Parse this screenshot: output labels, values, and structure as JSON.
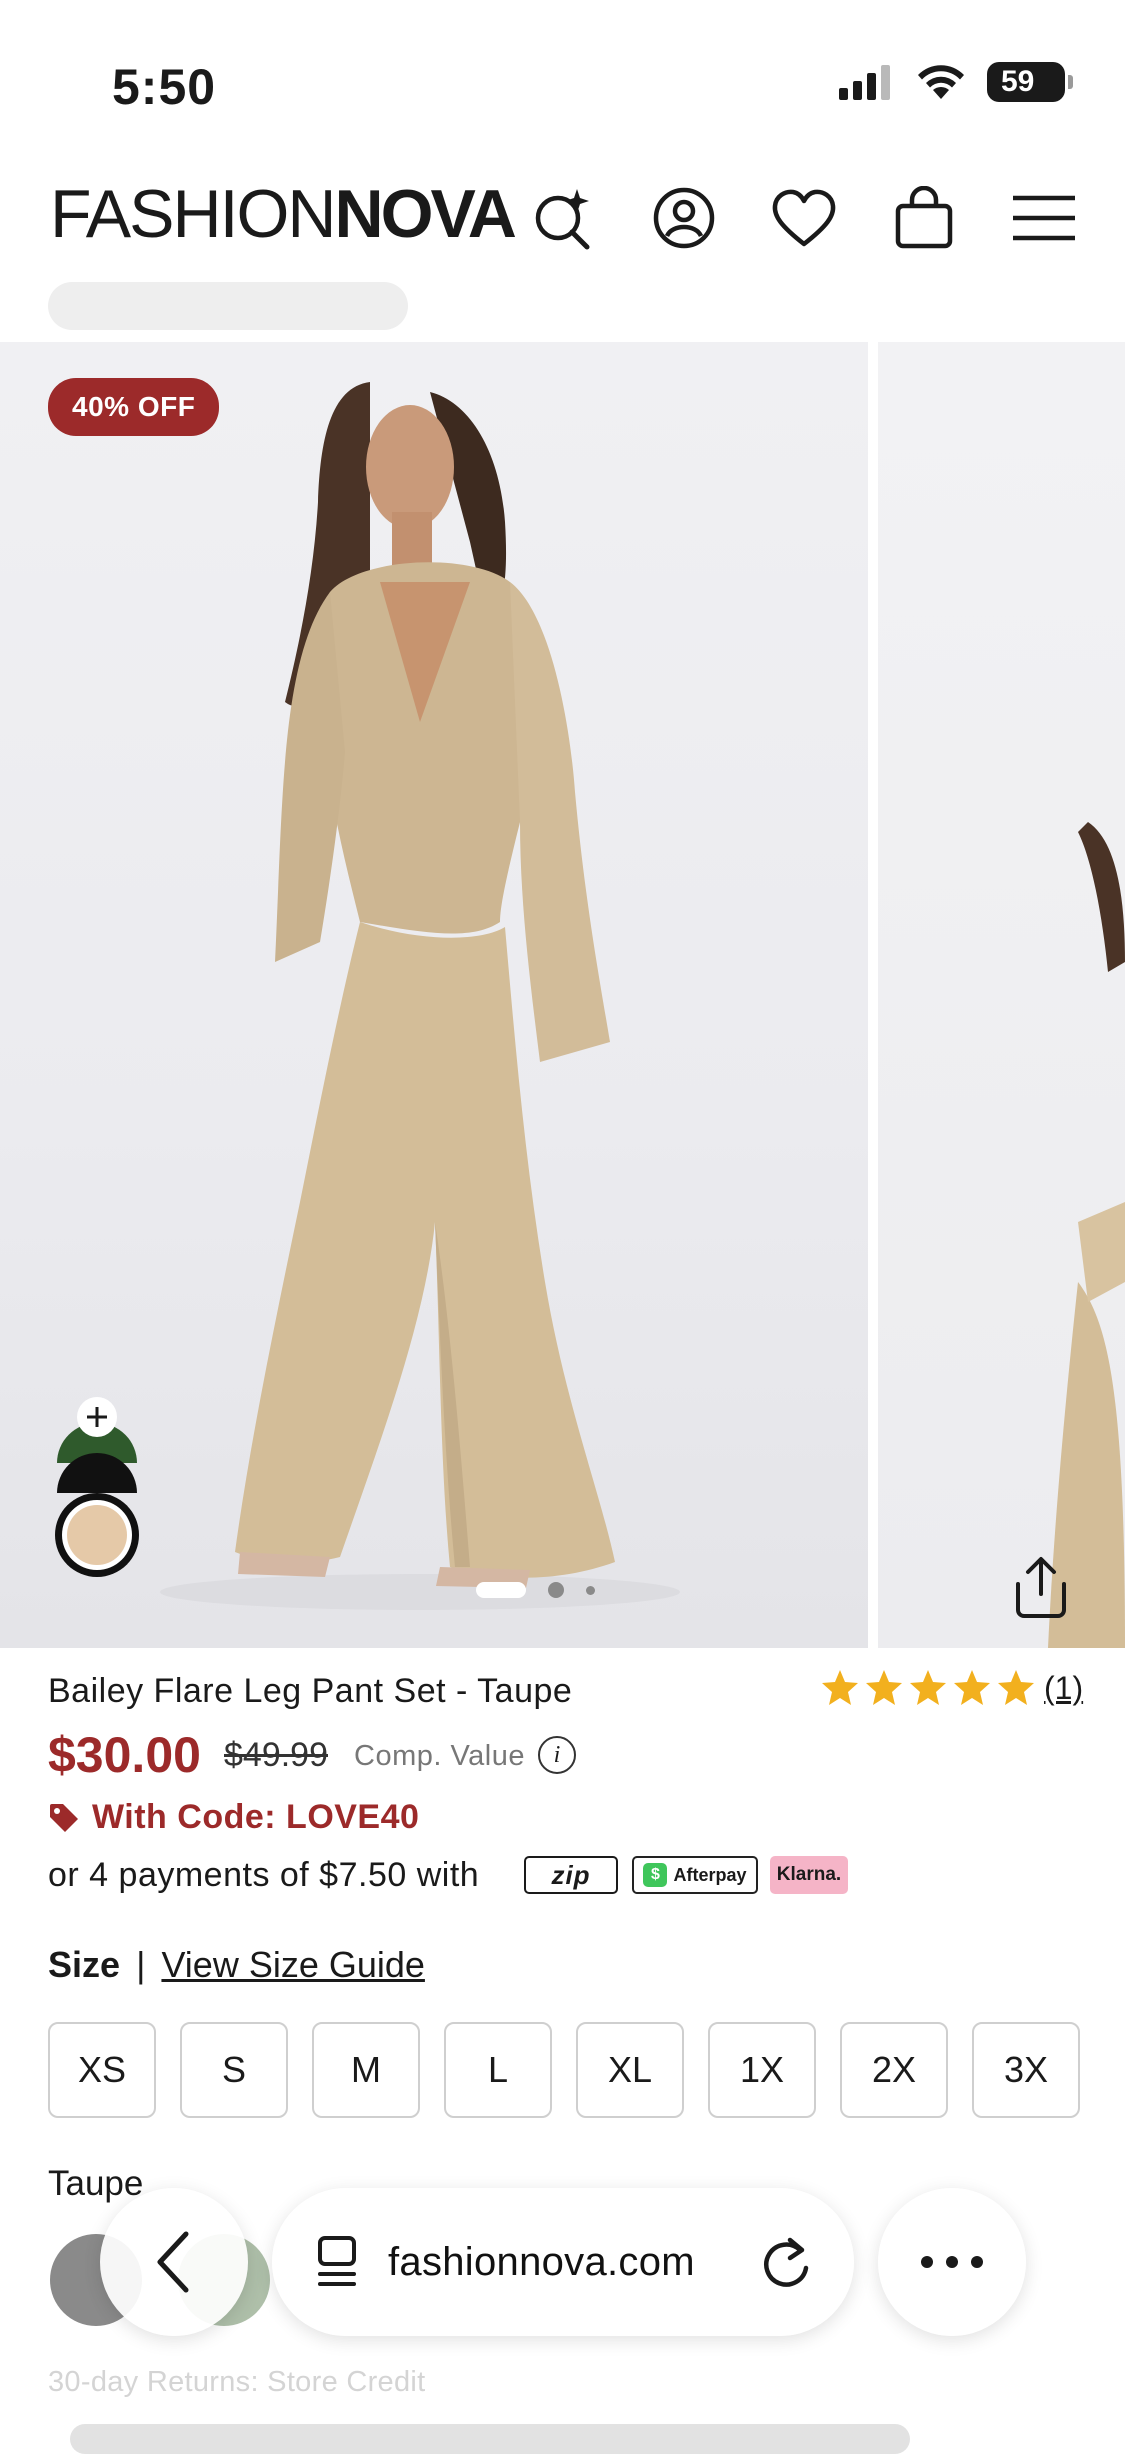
{
  "status_bar": {
    "time": "5:50",
    "battery": "59"
  },
  "header": {
    "logo_light": "FASHION",
    "logo_bold": "NOVA",
    "icons": [
      "search-sparkle-icon",
      "account-icon",
      "heart-icon",
      "bag-icon",
      "menu-icon"
    ]
  },
  "gallery": {
    "badge": "40% OFF",
    "share_icon": "share-icon"
  },
  "swatch_stack": {
    "plus_icon": "plus-icon",
    "colors": [
      "#2f5a2c",
      "#111111",
      "#e5c9a8"
    ]
  },
  "product": {
    "title": "Bailey Flare Leg Pant Set - Taupe",
    "rating": 5,
    "review_count": "(1)",
    "price": "$30.00",
    "original_price": "$49.99",
    "comp_value_label": "Comp. Value",
    "promo_code": "With Code: LOVE40",
    "payments_text": "or 4 payments of $7.50 with",
    "pay_providers": {
      "zip": "zip",
      "afterpay": "Afterpay",
      "klarna": "Klarna."
    },
    "accent_color": "#9c2a2a"
  },
  "size": {
    "label": "Size",
    "separator": "|",
    "guide": "View Size Guide",
    "options": [
      "XS",
      "S",
      "M",
      "L",
      "XL",
      "1X",
      "2X",
      "3X"
    ]
  },
  "color": {
    "label": "Taupe"
  },
  "browser": {
    "url": "fashionnova.com"
  },
  "footer": {
    "returns": "30-day Returns: Store Credit"
  }
}
